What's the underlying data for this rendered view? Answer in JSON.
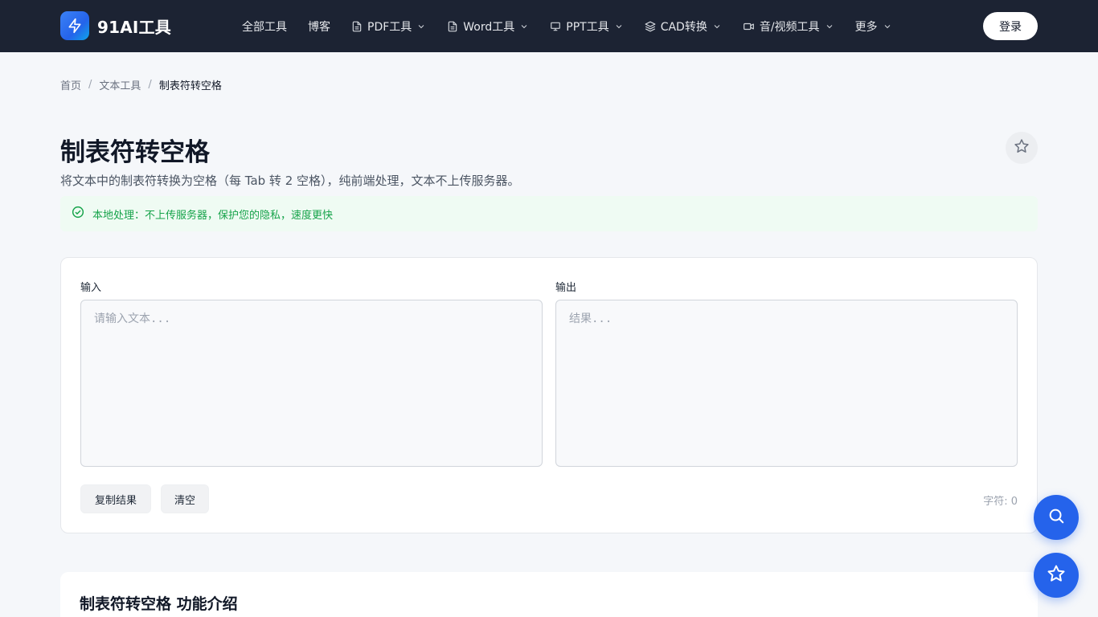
{
  "header": {
    "logo_text": "91AI工具",
    "logo_icon": "lightning-bolt-icon",
    "nav": [
      {
        "label": "全部工具",
        "icon": "",
        "dropdown": false
      },
      {
        "label": "博客",
        "icon": "",
        "dropdown": false
      },
      {
        "label": "PDF工具",
        "icon": "file-icon",
        "dropdown": true
      },
      {
        "label": "Word工具",
        "icon": "file-icon",
        "dropdown": true
      },
      {
        "label": "PPT工具",
        "icon": "presentation-icon",
        "dropdown": true
      },
      {
        "label": "CAD转换",
        "icon": "layers-icon",
        "dropdown": true
      },
      {
        "label": "音/视频工具",
        "icon": "video-icon",
        "dropdown": true
      },
      {
        "label": "更多",
        "icon": "",
        "dropdown": true
      }
    ],
    "login_label": "登录"
  },
  "breadcrumb": {
    "home": "首页",
    "category": "文本工具",
    "current": "制表符转空格",
    "separator": "/"
  },
  "page": {
    "title": "制表符转空格",
    "description": "将文本中的制表符转换为空格（每 Tab 转 2 空格），纯前端处理，文本不上传服务器。",
    "notice": "本地处理：不上传服务器，保护您的隐私，速度更快"
  },
  "tool": {
    "input_label": "输入",
    "input_placeholder": "请输入文本...",
    "input_value": "",
    "output_label": "输出",
    "output_placeholder": "结果...",
    "output_value": "",
    "copy_label": "复制结果",
    "clear_label": "清空",
    "char_count_label": "字符: 0"
  },
  "intro": {
    "title": "制表符转空格 功能介绍"
  },
  "fabs": {
    "search_icon": "search-icon",
    "favorite_icon": "star-icon"
  },
  "colors": {
    "header_bg": "#1c2333",
    "accent": "#2563eb",
    "notice_bg": "#effbf3",
    "notice_text": "#16a34a"
  }
}
